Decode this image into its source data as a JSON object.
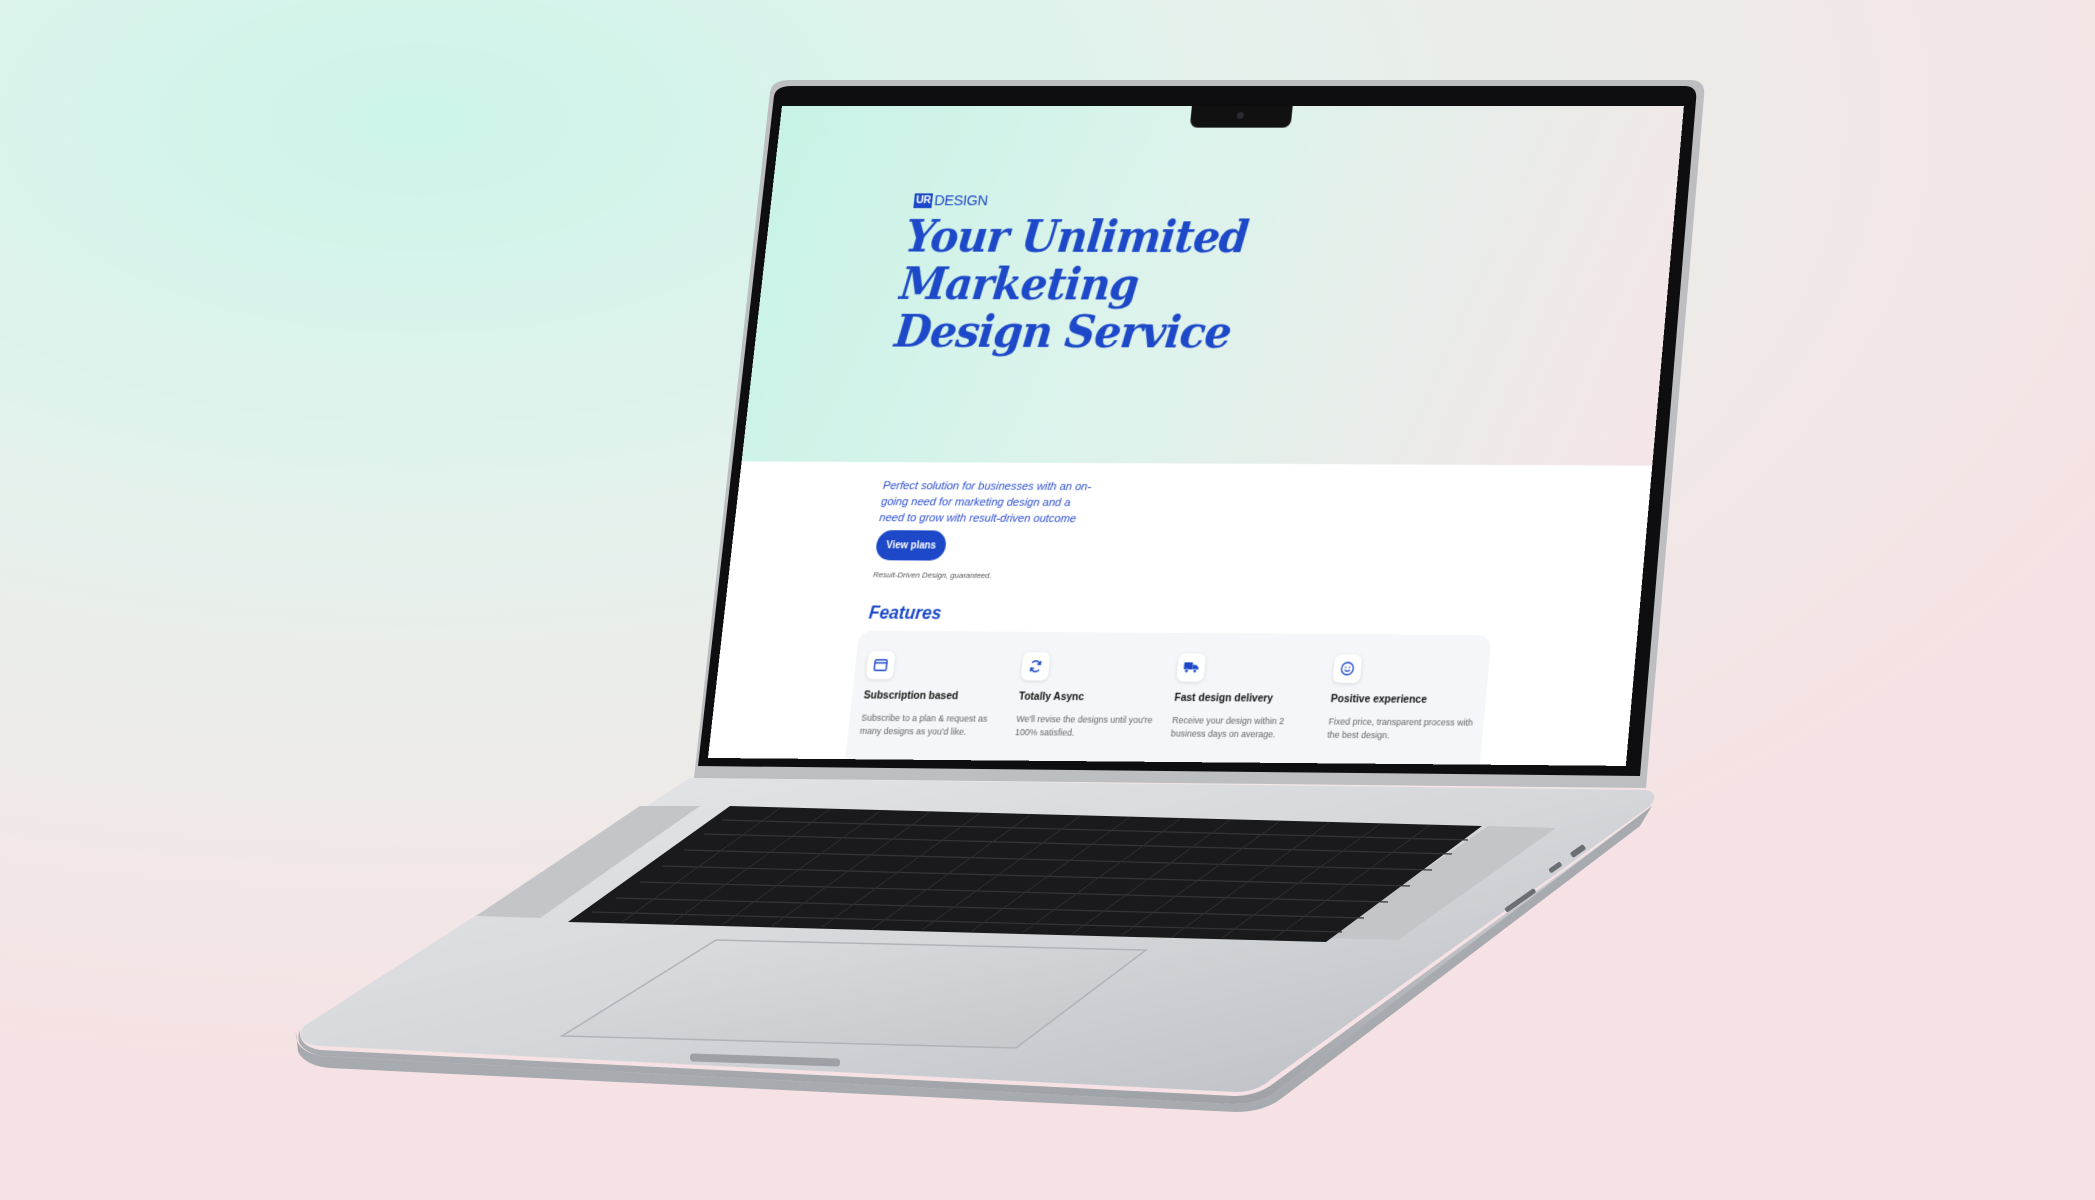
{
  "website": {
    "logo": {
      "mark": "UR",
      "word": "DESIGN"
    },
    "hero_title_lines": [
      "Your Unlimited",
      "Marketing",
      "Design Service"
    ],
    "hero_description": "Perfect solution for businesses with an on-going need for marketing design and a need to grow with result-driven outcome",
    "cta_label": "View plans",
    "tagline": "Result-Driven Design, guaranteed.",
    "features_heading": "Features",
    "features": [
      {
        "icon": "browser-window-icon",
        "title": "Subscription based",
        "description": "Subscribe to a plan & request as many designs as you'd like."
      },
      {
        "icon": "refresh-icon",
        "title": "Totally Async",
        "description": "We'll revise the designs until you're 100% satisfied."
      },
      {
        "icon": "delivery-truck-icon",
        "title": "Fast design delivery",
        "description": "Receive your design within 2 business days on average."
      },
      {
        "icon": "smiley-face-icon",
        "title": "Positive experience",
        "description": "Fixed price, transparent process with the best design."
      }
    ]
  },
  "colors": {
    "brand_blue": "#1d49c9",
    "hero_mint": "#c8f3e6",
    "hero_pink": "#f5e5e7",
    "laptop_silver": "#c9cbcf",
    "keyboard": "#1a1a1c"
  }
}
